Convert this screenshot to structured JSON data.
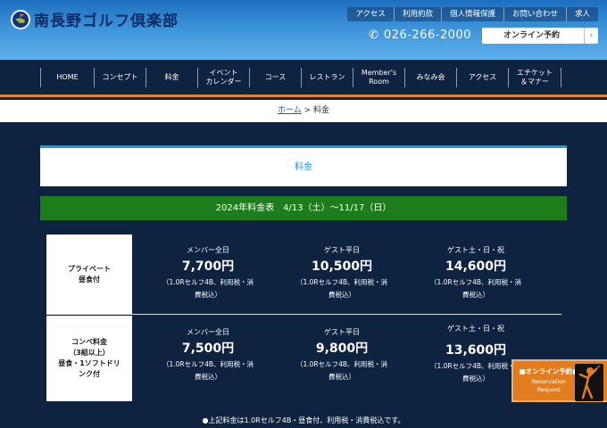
{
  "header": {
    "logo_text": "南長野ゴルフ倶楽部",
    "top_links": [
      "アクセス",
      "利用約款",
      "個人情報保護",
      "お問い合わせ",
      "求人"
    ],
    "phone": "026-266-2000",
    "reserve_button": "オンライン予約"
  },
  "nav": {
    "items": [
      "HOME",
      "コンセプト",
      "料金",
      "イベント\nカレンダー",
      "コース",
      "レストラン",
      "Member's\nRoom",
      "みなみ会",
      "アクセス",
      "エチケット\n＆マナー"
    ]
  },
  "breadcrumb": {
    "home": "ホーム",
    "separator": " > ",
    "current": "料金"
  },
  "page_title": "料金",
  "table_heading": "2024年料金表　4/13（土）～11/17（日）",
  "rows": [
    {
      "label": "プライベート\n昼食付",
      "cells": [
        {
          "label": "メンバー全日",
          "price": "7,700円",
          "note": "（1.0Rセルフ4B、利用税・消\n費税込）"
        },
        {
          "label": "ゲスト平日",
          "price": "10,500円",
          "note": "（1.0Rセルフ4B、利用税・消\n費税込）"
        },
        {
          "label": "ゲスト土・日・祝",
          "price": "14,600円",
          "note": "（1.0Rセルフ4B、利用税・消\n費税込）"
        }
      ]
    },
    {
      "label": "コンペ料金\n（3組以上）\n昼食・1ソフトドリ\nンク付",
      "cells": [
        {
          "label": "メンバー全日",
          "price": "7,500円",
          "note": "（1.0Rセルフ4B、利用税・消\n費税込）"
        },
        {
          "label": "ゲスト平日",
          "price": "9,800円",
          "note": "（1.0Rセルフ4B、利用税・消\n費税込）"
        },
        {
          "label": "ゲスト土・日・祝",
          "price": "13,600円",
          "note": "（1.0Rセルフ4B、利用税・消\n費税込）"
        }
      ]
    }
  ],
  "footnote": "●上記料金は1.0Rセルフ4B・昼食付、利用税・消費税込です。",
  "float_reserve": {
    "jp": "■オンライン予約■",
    "en": "Reservation\nRequest"
  },
  "colors": {
    "navy": "#0d2340",
    "orange": "#e3832a",
    "green": "#1d7d1a",
    "accent_blue": "#1a9ad6"
  }
}
